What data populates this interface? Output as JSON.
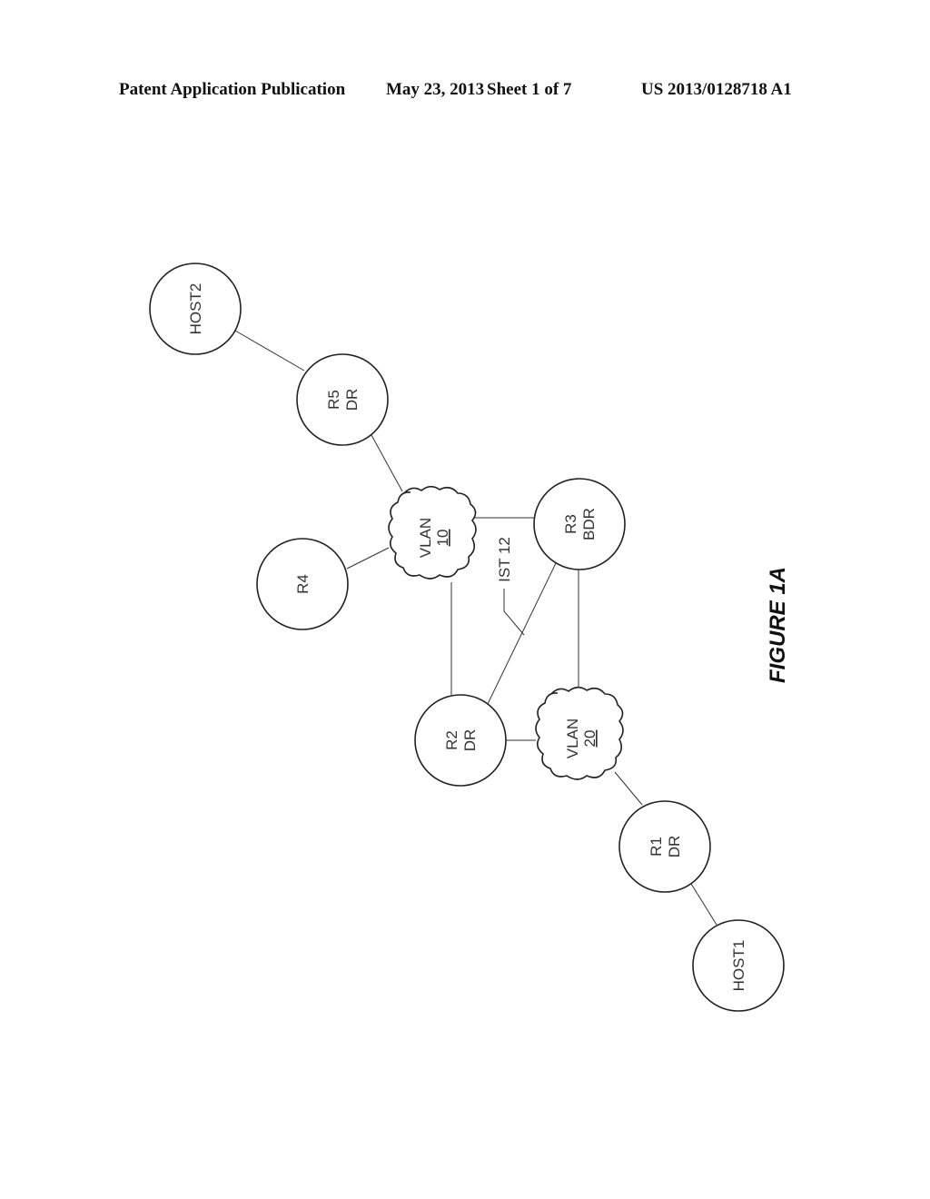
{
  "header": {
    "publication": "Patent Application Publication",
    "date": "May 23, 2013",
    "sheet": "Sheet 1 of 7",
    "doc_number": "US 2013/0128718 A1"
  },
  "diagram": {
    "figure_label": "FIGURE 1A",
    "nodes": [
      {
        "id": "host2",
        "lines": [
          "HOST2"
        ]
      },
      {
        "id": "r5",
        "lines": [
          "R5",
          "DR"
        ]
      },
      {
        "id": "r4",
        "lines": [
          "R4"
        ]
      },
      {
        "id": "r3",
        "lines": [
          "R3",
          "BDR"
        ]
      },
      {
        "id": "r2",
        "lines": [
          "R2",
          "DR"
        ]
      },
      {
        "id": "r1",
        "lines": [
          "R1",
          "DR"
        ]
      },
      {
        "id": "host1",
        "lines": [
          "HOST1"
        ]
      }
    ],
    "clouds": [
      {
        "id": "vlan10",
        "label": "VLAN",
        "number": "10"
      },
      {
        "id": "vlan20",
        "label": "VLAN",
        "number": "20"
      }
    ],
    "edges": [
      [
        "host2",
        "r5"
      ],
      [
        "r5",
        "vlan10"
      ],
      [
        "r4",
        "vlan10"
      ],
      [
        "vlan10",
        "r3"
      ],
      [
        "vlan10",
        "r2"
      ],
      [
        "r2",
        "r3"
      ],
      [
        "r3",
        "vlan20"
      ],
      [
        "r2",
        "vlan20"
      ],
      [
        "vlan20",
        "r1"
      ],
      [
        "r1",
        "host1"
      ]
    ],
    "annotation": {
      "label": "IST 12",
      "points_to": "r2-r3 link"
    }
  }
}
